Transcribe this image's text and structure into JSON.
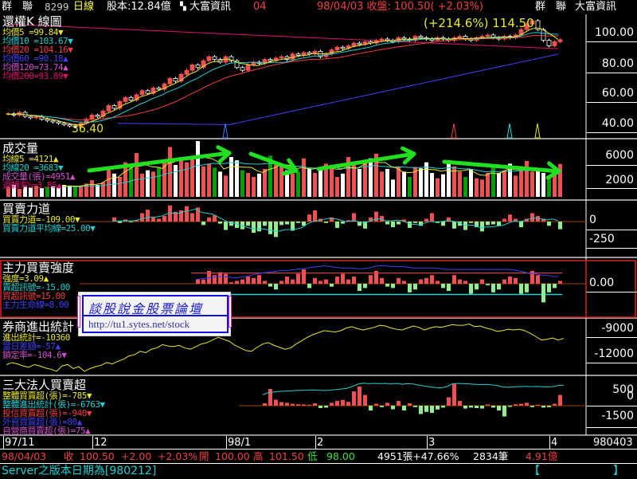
{
  "header": {
    "stock_name": "群　聯",
    "stock_code": "8299",
    "period": "日線",
    "capital": "股本:12.84億",
    "source": "大富資訊",
    "tab": "04",
    "quote": "98/04/03 收盤: 100.50( +2.03%)",
    "right_name": "群　聯",
    "right_source": "大富資訊"
  },
  "colors": {
    "up": "#f05050",
    "down_white": "#ffffff",
    "down_green": "#00a000",
    "neg": "#90f090",
    "ma5": "#e8e830",
    "ma10": "#20d0d0",
    "ma20": "#f04040",
    "ma60": "#4040f0",
    "ma120": "#d050d0",
    "ma200": "#e01070",
    "arrow": "#20e020"
  },
  "kline": {
    "title": "還權K 線圖",
    "legend": [
      {
        "label": "均價5  =99.84▼",
        "color": "#e8e830"
      },
      {
        "label": "均價10 =103.67▼",
        "color": "#20d0d0"
      },
      {
        "label": "均價20 =104.16▼",
        "color": "#f04040"
      },
      {
        "label": "均價60 =90.18▲",
        "color": "#4040f0"
      },
      {
        "label": "均價120=73.74▲",
        "color": "#d050d0"
      },
      {
        "label": "均價200=93.89▼",
        "color": "#e01070"
      }
    ],
    "low_label": "36.40",
    "high_label": "(+214.6%) 114.50",
    "axis": [
      "100.00",
      "80.00",
      "60.00",
      "40.00"
    ],
    "ylim": [
      30,
      118
    ],
    "closes": [
      46,
      45,
      47,
      44,
      43,
      44,
      42,
      41,
      40,
      39,
      38,
      37,
      36.4,
      39,
      42,
      45,
      44,
      48,
      52,
      50,
      55,
      58,
      56,
      60,
      63,
      61,
      65,
      64,
      68,
      72,
      70,
      75,
      78,
      82,
      80,
      85,
      88,
      86,
      84,
      88,
      85,
      80,
      78,
      82,
      84,
      83,
      86,
      85,
      87,
      88,
      86,
      90,
      89,
      91,
      90,
      92,
      88,
      90,
      93,
      95,
      94,
      96,
      98,
      97,
      99,
      98,
      100,
      101,
      100,
      99,
      102,
      101,
      100,
      103,
      102,
      101,
      100,
      102,
      101,
      100,
      102,
      103,
      101,
      100,
      102,
      103,
      104,
      102,
      101,
      103,
      102,
      104,
      108,
      112,
      114.5,
      108,
      100,
      96,
      99,
      100.5
    ],
    "ma60_start": 48,
    "ma120_start": 78,
    "ma200_start": 112,
    "markers": [
      {
        "index": 39,
        "color": "#4080ff"
      },
      {
        "index": 80,
        "color": "#f04040"
      },
      {
        "index": 90,
        "color": "#20e0e0"
      },
      {
        "index": 95,
        "color": "#e8e830"
      }
    ]
  },
  "volume": {
    "title": "成交量",
    "legend": [
      {
        "label": "均線5   =4121▲",
        "color": "#e8e830"
      },
      {
        "label": "均線20  =3683▼",
        "color": "#20d0d0"
      },
      {
        "label": "成交量(張)=4951▲",
        "color": "#d050d0"
      },
      {
        "label": "週轉率%=3.85▲",
        "color": "#e01070"
      }
    ],
    "axis": [
      "6000",
      "2000"
    ],
    "max": 8400,
    "values": [
      1500,
      1800,
      1200,
      1600,
      1400,
      1700,
      1300,
      1500,
      1600,
      1400,
      1800,
      1700,
      1600,
      1500,
      2000,
      2500,
      1800,
      2200,
      4200,
      3500,
      3000,
      5200,
      4800,
      6600,
      3500,
      4000,
      3800,
      4500,
      5500,
      7500,
      4800,
      6000,
      5200,
      6200,
      8400,
      4600,
      5000,
      4400,
      3800,
      3200,
      6000,
      5500,
      4000,
      3600,
      3000,
      3500,
      4200,
      6200,
      4800,
      5000,
      4000,
      3500,
      3800,
      5800,
      4200,
      3600,
      4500,
      5000,
      4800,
      3000,
      3500,
      6000,
      4800,
      4200,
      5500,
      5800,
      6500,
      3800,
      4200,
      2600,
      4600,
      3800,
      3000,
      4500,
      4300,
      5200,
      3600,
      2800,
      3400,
      5000,
      4600,
      3800,
      3000,
      4200,
      2800,
      2600,
      3600,
      4800,
      3600,
      4000,
      5000,
      3200,
      4500,
      5400,
      3800,
      4200,
      3600,
      3000,
      3800,
      4951
    ]
  },
  "power": {
    "title": "買賣力道",
    "legend": [
      {
        "label": "買賣力道=-109.00▼",
        "color": "#e8e830"
      },
      {
        "label": "買賣力道平均線=25.00▼",
        "color": "#20d0d0"
      }
    ],
    "axis": [
      "0",
      "-250"
    ],
    "values": [
      0,
      0,
      0,
      0,
      0,
      0,
      0,
      0,
      0,
      0,
      0,
      0,
      0,
      0,
      0,
      0,
      0,
      0,
      0,
      60,
      -20,
      30,
      -10,
      20,
      120,
      170,
      60,
      40,
      80,
      230,
      140,
      160,
      220,
      120,
      200,
      -50,
      60,
      90,
      -30,
      -120,
      -60,
      -90,
      -110,
      -60,
      -160,
      -140,
      -60,
      -180,
      -220,
      -50,
      -40,
      -130,
      -20,
      -60,
      100,
      160,
      40,
      -20,
      60,
      -90,
      -30,
      20,
      120,
      -60,
      -100,
      60,
      140,
      80,
      -40,
      -80,
      -40,
      30,
      -90,
      -20,
      -60,
      40,
      120,
      -20,
      -60,
      60,
      -100,
      -60,
      -120,
      -20,
      -80,
      -140,
      -50,
      -40,
      -60,
      40,
      100,
      40,
      -80,
      40,
      120,
      80,
      40,
      -60,
      0,
      -109
    ]
  },
  "strength": {
    "title": "主力買賣強度",
    "legend": [
      {
        "label": "強度=3.09▲",
        "color": "#e8e830"
      },
      {
        "label": "賣超訊號=-15.00",
        "color": "#20d0d0"
      },
      {
        "label": "買超訊號=15.00",
        "color": "#f04040"
      },
      {
        "label": "主力生命線=8.00",
        "color": "#4040f0"
      }
    ],
    "axis": [
      "0.00"
    ],
    "values": [
      0,
      0,
      0,
      0,
      0,
      0,
      0,
      0,
      0,
      0,
      0,
      0,
      0,
      0,
      0,
      0,
      0,
      0,
      0,
      0,
      0,
      0,
      0,
      0,
      0,
      0,
      0,
      0,
      0,
      0,
      0,
      0,
      0,
      0,
      6,
      6,
      18,
      12,
      16,
      14,
      2,
      4,
      6,
      10,
      8,
      12,
      4,
      -4,
      -8,
      4,
      10,
      6,
      14,
      20,
      -6,
      8,
      4,
      6,
      -4,
      10,
      14,
      6,
      10,
      -10,
      -6,
      12,
      18,
      8,
      -4,
      -6,
      8,
      4,
      -12,
      -8,
      6,
      8,
      12,
      4,
      -6,
      -10,
      12,
      6,
      4,
      -14,
      -8,
      6,
      -2,
      -12,
      -8,
      6,
      10,
      8,
      -14,
      -12,
      18,
      12,
      -26,
      -12,
      -6,
      4
    ],
    "life_line": [
      2,
      2,
      2,
      2,
      2,
      2,
      2,
      2,
      2,
      2,
      2,
      2,
      2,
      2,
      2,
      2,
      2,
      2,
      2,
      2,
      2,
      2,
      2,
      2,
      2,
      2,
      2,
      2,
      2,
      2,
      2,
      2,
      2,
      2,
      6,
      7,
      8,
      9,
      10,
      10,
      9,
      8,
      9,
      10,
      12,
      14,
      15,
      16,
      17,
      18,
      18,
      19,
      20,
      21,
      22,
      23,
      24,
      25,
      24,
      23,
      22,
      22,
      22,
      21,
      21,
      22,
      24,
      25,
      25,
      24,
      24,
      24,
      23,
      22,
      22,
      22,
      22,
      22,
      21,
      20,
      20,
      20,
      20,
      20,
      20,
      20,
      20,
      20,
      20,
      20,
      20,
      19,
      18,
      16,
      14,
      14,
      12,
      12,
      10,
      10
    ]
  },
  "broker": {
    "title": "券商進出統計",
    "legend": [
      {
        "label": "進出統計=-10360",
        "color": "#e8e830"
      },
      {
        "label": "當日差額=-57▲",
        "color": "#4040f0"
      },
      {
        "label": "鎖定率=-104.6▼",
        "color": "#d050d0"
      }
    ],
    "axis": [
      "-9000",
      "-12000"
    ],
    "ylim": [
      -15800,
      -7900
    ],
    "values": [
      -14300,
      -14000,
      -14200,
      -14500,
      -14700,
      -14300,
      -14500,
      -14800,
      -15000,
      -15300,
      -14500,
      -14300,
      -14900,
      -14600,
      -15300,
      -14900,
      -14600,
      -14400,
      -14000,
      -14200,
      -13800,
      -13500,
      -13000,
      -12800,
      -12300,
      -12500,
      -12000,
      -11800,
      -11300,
      -11500,
      -11600,
      -11400,
      -11800,
      -12000,
      -11600,
      -11200,
      -11000,
      -10600,
      -10200,
      -10500,
      -10800,
      -11400,
      -11800,
      -12200,
      -12300,
      -11700,
      -11200,
      -11000,
      -11400,
      -11700,
      -12000,
      -11800,
      -11200,
      -10700,
      -10200,
      -9800,
      -9500,
      -9200,
      -9300,
      -9400,
      -9200,
      -8800,
      -8600,
      -8900,
      -9100,
      -8900,
      -8700,
      -8400,
      -8500,
      -8800,
      -9000,
      -9100,
      -8800,
      -8500,
      -8700,
      -9100,
      -8800,
      -8600,
      -8700,
      -8500,
      -8300,
      -8400,
      -8400,
      -8200,
      -8600,
      -8500,
      -8800,
      -9000,
      -9300,
      -9200,
      -9000,
      -9100,
      -9000,
      -9200,
      -9600,
      -10100,
      -10600,
      -10500,
      -10300,
      -10600,
      -10360
    ]
  },
  "institutional": {
    "title": "三大法人買賣超",
    "legend": [
      {
        "label": "整體買賣超(張)=-785▼",
        "color": "#e8e830"
      },
      {
        "label": "整體進出統計(張)=-6763▼",
        "color": "#20d0d0"
      },
      {
        "label": "投信買賣超(張)=-940▼",
        "color": "#f04040"
      },
      {
        "label": "外資買賣超(張)=80▲",
        "color": "#4040f0"
      },
      {
        "label": "自營商買賣超(張)=75▲",
        "color": "#d050d0"
      }
    ],
    "axis": [
      "500",
      "0",
      "-1500"
    ],
    "values": [
      0,
      0,
      0,
      0,
      0,
      0,
      0,
      0,
      0,
      0,
      0,
      0,
      0,
      0,
      0,
      0,
      0,
      0,
      0,
      0,
      0,
      0,
      0,
      0,
      0,
      0,
      0,
      0,
      0,
      0,
      0,
      0,
      0,
      0,
      0,
      0,
      0,
      0,
      0,
      0,
      0,
      0,
      0,
      0,
      0,
      0,
      100,
      700,
      250,
      150,
      120,
      80,
      60,
      50,
      40,
      100,
      -100,
      -80,
      120,
      200,
      240,
      160,
      600,
      800,
      450,
      -200,
      80,
      -60,
      120,
      -150,
      200,
      -200,
      100,
      -60,
      -350,
      -260,
      -300,
      -160,
      -80,
      350,
      900,
      200,
      -120,
      -80,
      -100,
      -120,
      50,
      -80,
      -200,
      -450,
      -50,
      60,
      80,
      120,
      -60,
      40,
      -80,
      -60,
      80,
      450
    ],
    "line": [
      -12000,
      -11500,
      -11000,
      -10500,
      -10000,
      -9600,
      -9300,
      -9000,
      -8800,
      -8600,
      -8400,
      -8200,
      -8000,
      -7900,
      -7800,
      -7700,
      -7600,
      -7500,
      -7400,
      -7300,
      -7200,
      -7100,
      -7000,
      -6900,
      -6800,
      -6700,
      -6600,
      -6500,
      -6400,
      -6300,
      -6200,
      -6100,
      -6000,
      -5900,
      -5800,
      -5700,
      -5600,
      -5500,
      -5400,
      -5300,
      -5200,
      -5100,
      -5000,
      -4900,
      -4800,
      -4700,
      -4600,
      -3900,
      -3700,
      -3500,
      -3400,
      -3300,
      -3200,
      -3100,
      -3050,
      -3000,
      -3100,
      -3200,
      -3100,
      -2900,
      -2700,
      -2500,
      -1900,
      -1100,
      -700,
      -900,
      -800,
      -900,
      -800,
      -1000,
      -800,
      -1100,
      -900,
      -1000,
      -1400,
      -1700,
      -2000,
      -2200,
      -2300,
      -1900,
      -1000,
      -800,
      -900,
      -1000,
      -1100,
      -1200,
      -1150,
      -1300,
      -1500,
      -2000,
      -2100,
      -2000,
      -1900,
      -1800,
      -1900,
      -1850,
      -1900,
      -2000,
      -1900,
      -1500,
      -1400
    ],
    "display_order_note": ""
  },
  "watermark": {
    "title": "談股說金股票論壇",
    "url": "http://tu1.sytes.net/stock"
  },
  "dates": {
    "labels": [
      "97/11",
      "12",
      "98/1",
      "2",
      "3",
      "4"
    ],
    "label_index": [
      0,
      16,
      40,
      56,
      76,
      98
    ],
    "current": "980403"
  },
  "info": {
    "date": "98/04/03",
    "close_label": "收",
    "close": "100.50",
    "change": "+2.00",
    "pct": "+2.03%",
    "open_label": "開",
    "open": "100.00",
    "high_label": "高",
    "high": "101.50",
    "low_label": "低",
    "low": "98.00",
    "volume": "4951張+47.66%",
    "trades": "2834筆",
    "amount": "4.91億"
  },
  "status": {
    "message": "Server之版本日期為[980212]",
    "bracket_left": "【",
    "bracket_right": "】"
  }
}
